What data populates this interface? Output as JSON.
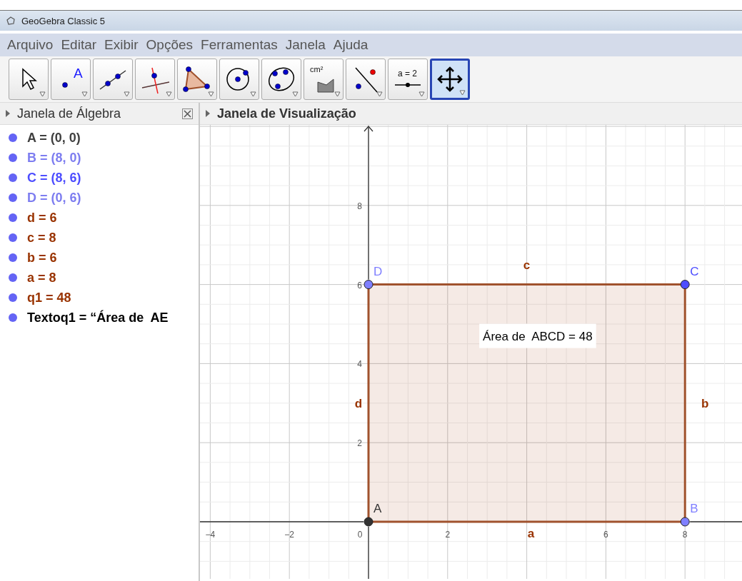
{
  "window": {
    "title": "GeoGebra Classic 5"
  },
  "menu": [
    "Arquivo",
    "Editar",
    "Exibir",
    "Opções",
    "Ferramentas",
    "Janela",
    "Ajuda"
  ],
  "toolbar": [
    {
      "kind": "pointer",
      "selected": false
    },
    {
      "kind": "point",
      "text": "A",
      "selected": false
    },
    {
      "kind": "line",
      "selected": false
    },
    {
      "kind": "perpendicular",
      "selected": false
    },
    {
      "kind": "polygon",
      "selected": false
    },
    {
      "kind": "circle",
      "selected": false
    },
    {
      "kind": "ellipse",
      "selected": false
    },
    {
      "kind": "area",
      "text": "cm²",
      "selected": false
    },
    {
      "kind": "reflect",
      "selected": false
    },
    {
      "kind": "slider",
      "text": "a = 2",
      "selected": false
    },
    {
      "kind": "move-view",
      "selected": true
    }
  ],
  "algebra": {
    "title": "Janela de Álgebra",
    "items": [
      {
        "text": "A = (0, 0)",
        "color": "#404040"
      },
      {
        "text": "B = (8, 0)",
        "color": "#7d7df0"
      },
      {
        "text": "C = (8, 6)",
        "color": "#4d4dff"
      },
      {
        "text": "D = (0, 6)",
        "color": "#7d7df0"
      },
      {
        "text": "d = 6",
        "color": "#993300"
      },
      {
        "text": "c = 8",
        "color": "#993300"
      },
      {
        "text": "b = 6",
        "color": "#993300"
      },
      {
        "text": "a = 8",
        "color": "#993300"
      },
      {
        "text": "q1 = 48",
        "color": "#993300"
      },
      {
        "text": "Textoq1 = “Área de  AE",
        "color": "#000000"
      }
    ]
  },
  "graphics": {
    "title": "Janela de Visualização",
    "y_axis_labels": [
      "8",
      "6",
      "4",
      "2"
    ],
    "vertices": [
      {
        "name": "D",
        "color": "#7f7fff"
      },
      {
        "name": "C",
        "color": "#4d4dff"
      },
      {
        "name": "A",
        "color": "#333333"
      },
      {
        "name": "B",
        "color": "#7f7fff"
      }
    ],
    "side_labels": [
      "c",
      "d",
      "b",
      "a"
    ],
    "text_box": "Área de  ABCD = 48",
    "x_axis_labels": [
      "−4",
      "−2",
      "0",
      "2",
      "6",
      "8"
    ]
  }
}
